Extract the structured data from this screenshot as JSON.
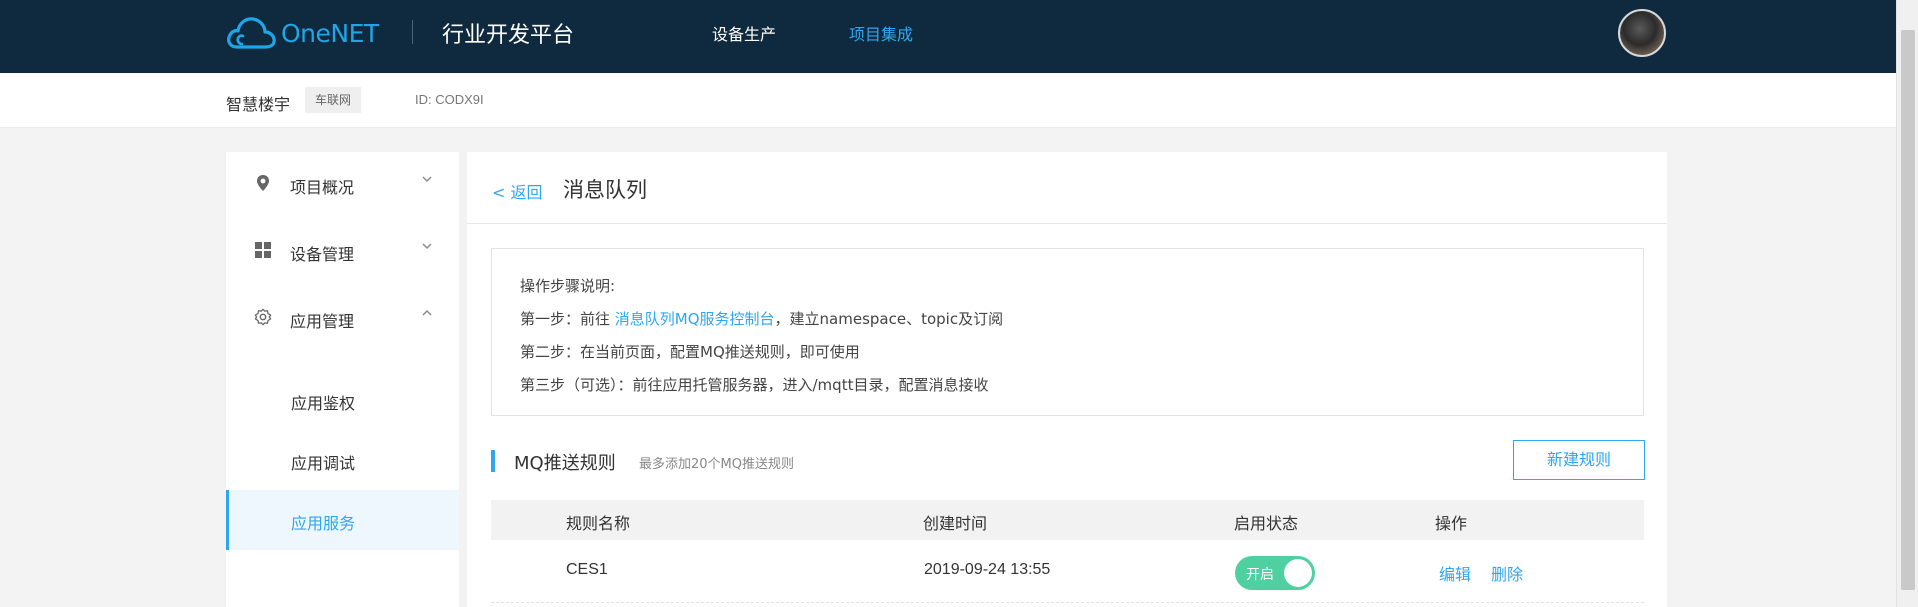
{
  "header": {
    "logo_text": "OneNET",
    "platform_title": "行业开发平台",
    "nav": [
      {
        "label": "设备生产",
        "active": false
      },
      {
        "label": "项目集成",
        "active": true
      }
    ],
    "avatar_icon": "user-avatar"
  },
  "project": {
    "name": "智慧楼宇",
    "tag": "车联网",
    "id_text": "ID: CODX9I"
  },
  "sidebar": {
    "groups": [
      {
        "label": "项目概况",
        "icon": "location-pin-icon",
        "expanded": false
      },
      {
        "label": "设备管理",
        "icon": "grid-icon",
        "expanded": false
      },
      {
        "label": "应用管理",
        "icon": "gear-icon",
        "expanded": true
      }
    ],
    "subitems": [
      {
        "label": "应用鉴权",
        "active": false
      },
      {
        "label": "应用调试",
        "active": false
      },
      {
        "label": "应用服务",
        "active": true
      }
    ]
  },
  "main": {
    "back_label": "< 返回",
    "title": "消息队列",
    "steps": {
      "heading": "操作步骤说明:",
      "step1_prefix": "第一步：前往 ",
      "step1_link": "消息队列MQ服务控制台",
      "step1_suffix": "，建立namespace、topic及订阅",
      "step2": "第二步：在当前页面，配置MQ推送规则，即可使用",
      "step3": "第三步（可选）：前往应用托管服务器，进入/mqtt目录，配置消息接收"
    },
    "section": {
      "title": "MQ推送规则",
      "hint": "最多添加20个MQ推送规则",
      "new_button": "新建规则"
    },
    "table": {
      "columns": [
        "规则名称",
        "创建时间",
        "启用状态",
        "操作"
      ],
      "rows": [
        {
          "name": "CES1",
          "created": "2019-09-24 13:55",
          "status": "开启",
          "enabled": true,
          "edit": "编辑",
          "delete": "删除"
        }
      ]
    }
  },
  "colors": {
    "topbar": "#0f2a3f",
    "accent": "#2ea6f0",
    "toggle_on": "#4fd0a0"
  }
}
